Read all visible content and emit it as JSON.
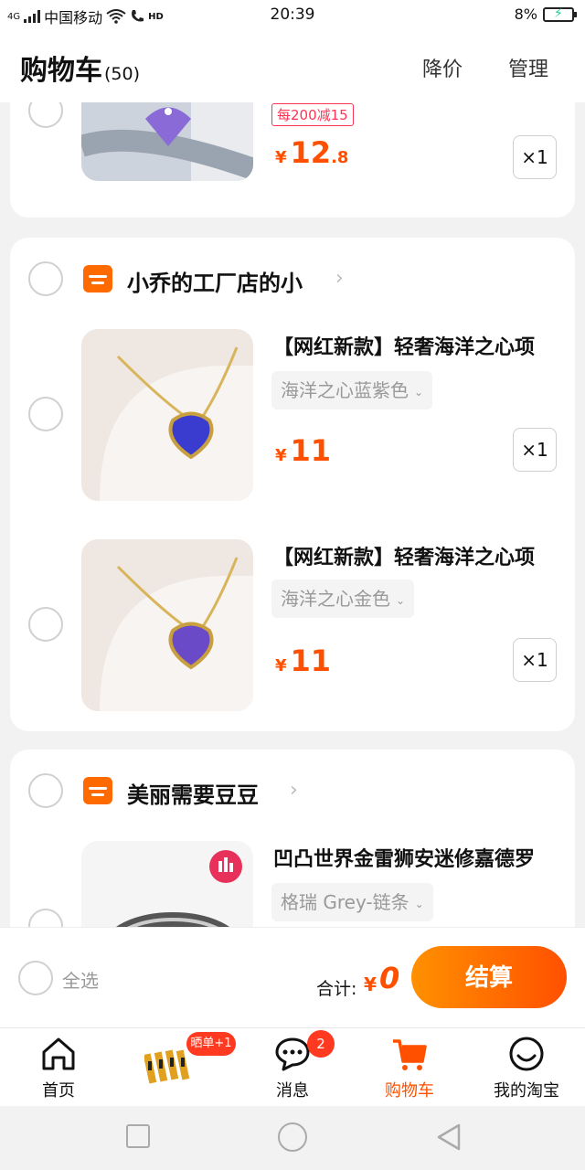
{
  "status_bar": {
    "network": "4G",
    "carrier": "中国移动",
    "hd": "HD",
    "time": "20:39",
    "battery": "8%"
  },
  "header": {
    "title": "购物车",
    "count": "(50)",
    "price_drop": "降价",
    "manage": "管理"
  },
  "items_top": [
    {
      "promo": "每200减15",
      "price_int": "12",
      "price_dec": ".8",
      "qty": "×1",
      "thumb_colors": {
        "bg": "#c9cfd8",
        "accent": "#8a6ad6"
      }
    }
  ],
  "shops": [
    {
      "name": "小乔的工厂店的小",
      "items": [
        {
          "title": "【网红新款】轻奢海洋之心项",
          "variant": "海洋之心蓝紫色",
          "price_int": "11",
          "price_dec": "",
          "qty": "×1",
          "thumb_colors": {
            "bg": "#efe8e2",
            "accent": "#3a3cd0"
          }
        },
        {
          "title": "【网红新款】轻奢海洋之心项",
          "variant": "海洋之心金色",
          "price_int": "11",
          "price_dec": "",
          "qty": "×1",
          "thumb_colors": {
            "bg": "#efe8e2",
            "accent": "#6a4ac6"
          }
        }
      ]
    },
    {
      "name": "美丽需要豆豆",
      "items": [
        {
          "title": "凹凸世界金雷狮安迷修嘉德罗",
          "variant": "格瑞 Grey-链条",
          "price_int": "",
          "price_dec": "",
          "qty": "",
          "thumb_colors": {
            "bg": "#f5f5f5",
            "accent": "#e8315a"
          }
        }
      ]
    }
  ],
  "checkout": {
    "select_all": "全选",
    "total_label": "合计:",
    "currency": "¥",
    "total": "0",
    "pay": "结算"
  },
  "tabs": [
    {
      "label": "首页",
      "icon": "home-icon",
      "active": false
    },
    {
      "label": "",
      "icon": "promo-banner-icon",
      "badge": "晒单+1",
      "active": false
    },
    {
      "label": "消息",
      "icon": "message-icon",
      "badge": "2",
      "active": false
    },
    {
      "label": "购物车",
      "icon": "cart-icon",
      "active": true
    },
    {
      "label": "我的淘宝",
      "icon": "profile-icon",
      "active": false
    }
  ],
  "colors": {
    "accent": "#ff5000",
    "accent_light": "#ff9000",
    "promo_red": "#ff3355",
    "badge_red": "#ff3a20"
  }
}
